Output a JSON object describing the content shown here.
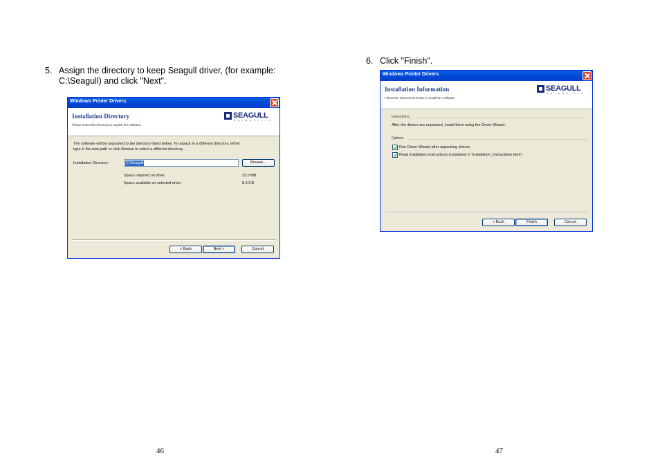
{
  "left": {
    "step_number": "5.",
    "step_text_line1": "Assign the directory to keep Seagull driver, (for example:",
    "step_text_line2": "C:\\Seagull) and click \"Next\".",
    "page_number": "46",
    "dialog": {
      "title": "Windows Printer Drivers",
      "header_title": "Installation Directory",
      "header_subtitle": "Please select the directory to unpack the software.",
      "logo_text": "SEAGULL",
      "logo_sub": "SCIENTIFIC",
      "desc_line1": "The software will be unpacked to the directory listed below.  To unpack to a different directory, either",
      "desc_line2": "type in the new path or click Browse to select a different directory.",
      "dir_label": "Installation Directory:",
      "dir_value": "C:\\Seagull",
      "browse_label": "Browse...",
      "space_required_label": "Space required on drive:",
      "space_required_value": "33.0 MB",
      "space_available_label": "Space available on selected drive:",
      "space_available_value": "8.3 GB",
      "back_label": "< Back",
      "next_label": "Next >",
      "cancel_label": "Cancel"
    }
  },
  "right": {
    "step_number": "6.",
    "step_text": "Click \"Finish\".",
    "page_number": "47",
    "dialog": {
      "title": "Windows Printer Drivers",
      "header_title": "Installation Information",
      "header_subtitle": "Follow the instructions below to install the software.",
      "logo_text": "SEAGULL",
      "logo_sub": "SCIENTIFIC",
      "instructions_group": "Instructions",
      "instructions_text": "After the drivers are unpacked, install them using the Driver Wizard.",
      "options_group": "Options",
      "option1": "Run Driver Wizard after unpacking drivers",
      "option2": "Read installation instructions (contained in 'Installation_Instructions.html')",
      "back_label": "< Back",
      "finish_label": "Finish",
      "cancel_label": "Cancel"
    }
  }
}
